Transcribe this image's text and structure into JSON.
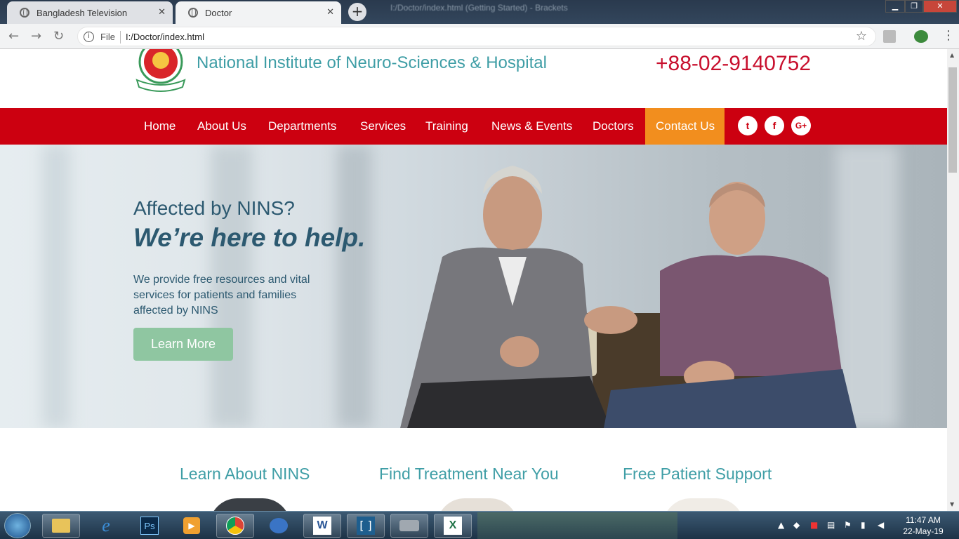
{
  "browser": {
    "tabs": [
      {
        "title": "Bangladesh Television"
      },
      {
        "title": "Doctor"
      }
    ],
    "window_title": "I:/Doctor/index.html (Getting Started) - Brackets",
    "address_prefix": "File",
    "url": "I:/Doctor/index.html"
  },
  "site": {
    "name": "National Institute of Neuro-Sciences & Hospital",
    "phone": "+88-02-9140752",
    "nav": [
      "Home",
      "About Us",
      "Departments",
      "Services",
      "Training",
      "News & Events",
      "Doctors",
      "Contact Us"
    ],
    "active_nav": "Contact Us",
    "social": [
      "twitter-icon",
      "facebook-icon",
      "google-plus-icon"
    ]
  },
  "hero": {
    "heading": "Affected by NINS?",
    "subheading": "We’re here to help.",
    "text": "We provide free resources and vital services for patients and families affected by NINS",
    "button": "Learn More"
  },
  "features": [
    {
      "title": "Learn About NINS"
    },
    {
      "title": "Find Treatment Near You"
    },
    {
      "title": "Free Patient Support"
    }
  ],
  "taskbar": {
    "apps": [
      "explorer-icon",
      "internet-explorer-icon",
      "photoshop-icon",
      "media-player-icon",
      "chrome-icon",
      "outlook-icon",
      "word-icon",
      "brackets-icon",
      "disk-icon",
      "excel-icon"
    ],
    "time": "11:47 AM",
    "date": "22-May-19"
  },
  "colors": {
    "nav_bg": "#cc0010",
    "nav_active": "#f28e1e",
    "title_teal": "#3f9ea6",
    "phone_red": "#c8102e",
    "button_green": "#8fc6a1"
  }
}
